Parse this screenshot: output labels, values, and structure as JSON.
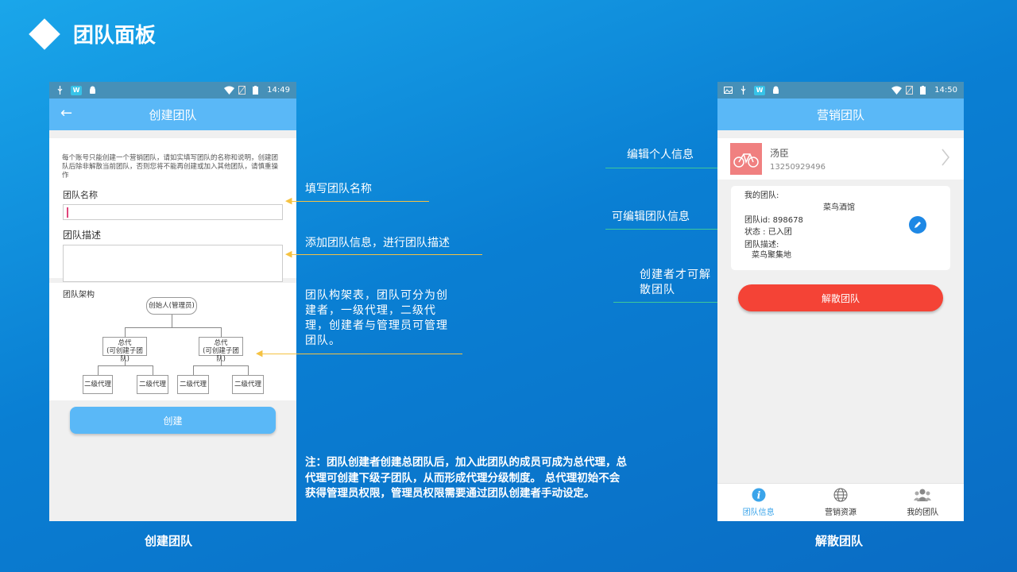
{
  "slide": {
    "title": "团队面板"
  },
  "left_phone": {
    "status_time": "14:49",
    "appbar_title": "创建团队",
    "notice": "每个账号只能创建一个营销团队，请如实填写团队的名称和说明，创建团队后除非解散当前团队，否则您将不能再创建或加入其他团队，请慎重操作",
    "name_label": "团队名称",
    "desc_label": "团队描述",
    "org_label": "团队架构",
    "org": {
      "root": "创始人(管理员)",
      "agent_left": "总代\n(可创建子团队)",
      "agent_right": "总代\n(可创建子团队)",
      "sub1": "二级代理",
      "sub2": "二级代理",
      "sub3": "二级代理",
      "sub4": "二级代理"
    },
    "create_button": "创建",
    "caption": "创建团队"
  },
  "right_phone": {
    "status_time": "14:50",
    "appbar_title": "营销团队",
    "user_name": "汤臣",
    "user_phone": "13250929496",
    "team_label": "我的团队:",
    "team_name": "菜鸟酒馆",
    "team_id": "团队id: 898678",
    "team_status": "状态 : 已入团",
    "team_desc_label": "团队描述:",
    "team_desc": "菜鸟聚集地",
    "disband_button": "解散团队",
    "tabs": [
      {
        "label": "团队信息",
        "icon": "info-icon"
      },
      {
        "label": "营销资源",
        "icon": "globe-icon"
      },
      {
        "label": "我的团队",
        "icon": "group-icon"
      }
    ],
    "caption": "解散团队"
  },
  "annotations": {
    "fill_name": "填写团队名称",
    "add_desc": "添加团队信息，进行团队描述",
    "org_desc": "团队构架表，团队可分为创建者，一级代理，二级代理，创建者与管理员可管理团队。",
    "edit_profile": "编辑个人信息",
    "edit_team": "可编辑团队信息",
    "creator_disband": "创建者才可解散团队"
  },
  "note": "注：团队创建者创建总团队后，加入此团队的成员可成为总代理，总代理可创建下级子团队，从而形成代理分级制度。 总代理初始不会获得管理员权限，管理员权限需要通过团队创建者手动设定。",
  "colors": {
    "accent": "#5ab8f7",
    "danger": "#f44336",
    "arrow_yellow": "#f5c242",
    "arrow_green": "#3ec89a"
  }
}
